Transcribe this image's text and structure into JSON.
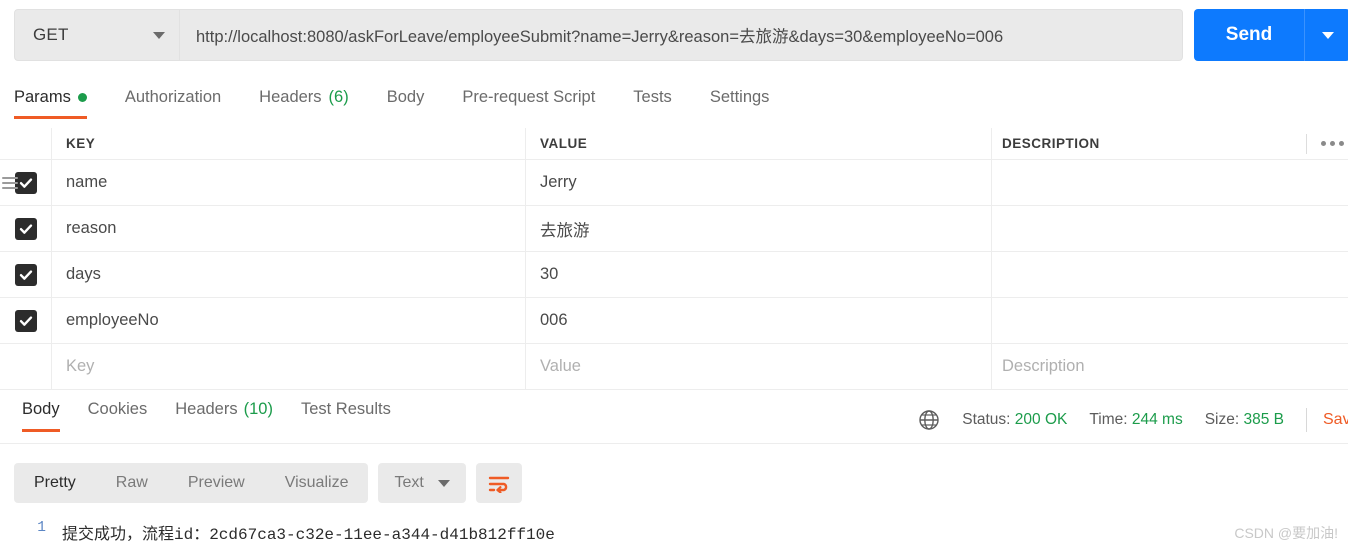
{
  "request": {
    "method": "GET",
    "url": "http://localhost:8080/askForLeave/employeeSubmit?name=Jerry&reason=去旅游&days=30&employeeNo=006",
    "send_label": "Send",
    "tabs": [
      {
        "label": "Params",
        "badge": "",
        "dot": true,
        "active": true
      },
      {
        "label": "Authorization",
        "badge": "",
        "dot": false,
        "active": false
      },
      {
        "label": "Headers",
        "badge": "(6)",
        "dot": false,
        "active": false
      },
      {
        "label": "Body",
        "badge": "",
        "dot": false,
        "active": false
      },
      {
        "label": "Pre-request Script",
        "badge": "",
        "dot": false,
        "active": false
      },
      {
        "label": "Tests",
        "badge": "",
        "dot": false,
        "active": false
      },
      {
        "label": "Settings",
        "badge": "",
        "dot": false,
        "active": false
      }
    ]
  },
  "params_table": {
    "headers": {
      "key": "KEY",
      "value": "VALUE",
      "description": "DESCRIPTION"
    },
    "rows": [
      {
        "checked": true,
        "key": "name",
        "value": "Jerry",
        "description": ""
      },
      {
        "checked": true,
        "key": "reason",
        "value": "去旅游",
        "description": ""
      },
      {
        "checked": true,
        "key": "days",
        "value": "30",
        "description": ""
      },
      {
        "checked": true,
        "key": "employeeNo",
        "value": "006",
        "description": ""
      }
    ],
    "placeholder_row": {
      "key": "Key",
      "value": "Value",
      "description": "Description"
    }
  },
  "response": {
    "tabs": [
      {
        "label": "Body",
        "badge": "",
        "active": true
      },
      {
        "label": "Cookies",
        "badge": "",
        "active": false
      },
      {
        "label": "Headers",
        "badge": "(10)",
        "active": false
      },
      {
        "label": "Test Results",
        "badge": "",
        "active": false
      }
    ],
    "status_label": "Status:",
    "status_value": "200 OK",
    "time_label": "Time:",
    "time_value": "244 ms",
    "size_label": "Size:",
    "size_value": "385 B",
    "save_label": "Save Response",
    "format_tabs": [
      {
        "label": "Pretty",
        "active": true
      },
      {
        "label": "Raw",
        "active": false
      },
      {
        "label": "Preview",
        "active": false
      },
      {
        "label": "Visualize",
        "active": false
      }
    ],
    "content_type": "Text",
    "body_lines": [
      {
        "number": "1",
        "text": "提交成功，流程id：2cd67ca3-c32e-11ee-a344-d41b812ff10e"
      }
    ]
  },
  "watermark": "CSDN @要加油!",
  "colors": {
    "accent_orange": "#ef5b25",
    "send_blue": "#0d7afe",
    "status_green": "#1c9c4b"
  }
}
